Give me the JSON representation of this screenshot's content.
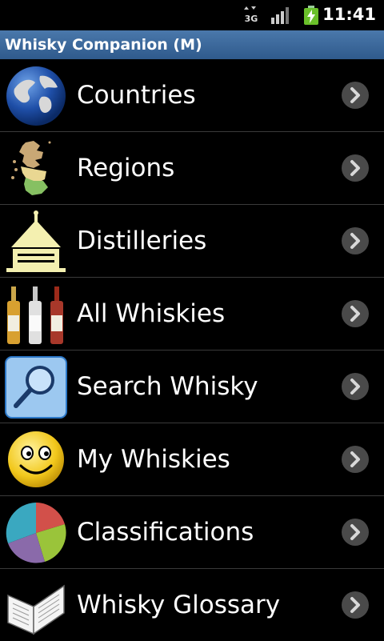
{
  "status_bar": {
    "network": "3G",
    "time": "11:41"
  },
  "title_bar": {
    "title": "Whisky Companion (M)"
  },
  "menu": [
    {
      "label": "Countries",
      "icon": "globe-icon"
    },
    {
      "label": "Regions",
      "icon": "scotland-map-icon"
    },
    {
      "label": "Distilleries",
      "icon": "pagoda-icon"
    },
    {
      "label": "All Whiskies",
      "icon": "bottles-icon"
    },
    {
      "label": "Search Whisky",
      "icon": "magnifier-icon"
    },
    {
      "label": "My Whiskies",
      "icon": "smiley-icon"
    },
    {
      "label": "Classifications",
      "icon": "pie-chart-icon"
    },
    {
      "label": "Whisky Glossary",
      "icon": "book-icon"
    }
  ],
  "colors": {
    "titlebar": "#3a6698",
    "background": "#000000",
    "chevron_bg": "#4a4a4a"
  }
}
